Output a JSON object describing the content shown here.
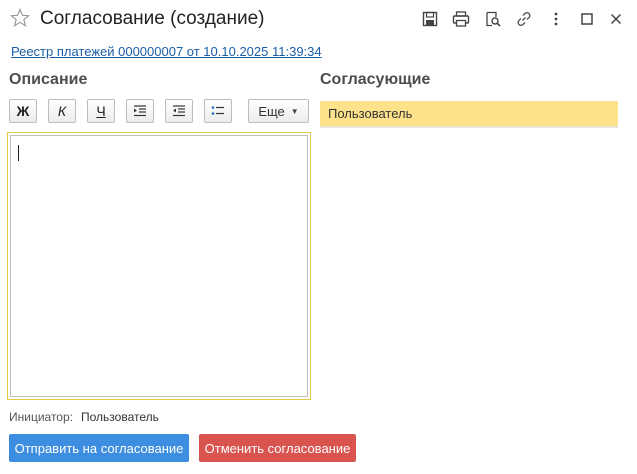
{
  "window": {
    "title": "Согласование (создание)",
    "icons": [
      "star-icon",
      "save-icon",
      "print-icon",
      "preview-icon",
      "link-icon",
      "more-vertical-icon",
      "maximize-icon",
      "close-icon"
    ]
  },
  "document_link": "Реестр платежей 000000007 от 10.10.2025 11:39:34",
  "description": {
    "heading": "Описание",
    "toolbar": {
      "bold": "Ж",
      "italic": "К",
      "underline": "Ч",
      "more_label": "Еще"
    },
    "text": ""
  },
  "approvers": {
    "heading": "Согласующие",
    "rows": [
      {
        "name": "Пользователь"
      }
    ]
  },
  "initiator": {
    "label": "Инициатор:",
    "value": "Пользователь"
  },
  "buttons": {
    "send": "Отправить на согласование",
    "cancel": "Отменить согласование"
  },
  "colors": {
    "link": "#1a5ea8",
    "selected_row": "#fde28b",
    "editor_focus": "#e6c84a",
    "send_button": "#3d8ee0",
    "cancel_button": "#d9534f"
  }
}
